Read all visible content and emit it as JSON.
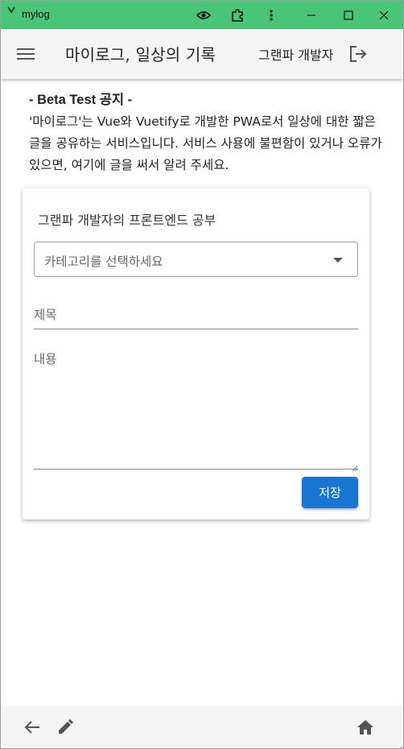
{
  "window": {
    "title": "mylog",
    "app_icon": "chevron-logo-icon",
    "buttons": [
      "eye-icon",
      "extension-icon",
      "more-vert-icon",
      "minimize-icon",
      "maximize-icon",
      "close-icon"
    ]
  },
  "appbar": {
    "title": "마이로그, 일상의 기록",
    "user_name": "그랜파 개발자",
    "menu_icon": "hamburger-menu-icon",
    "logout_icon": "logout-icon"
  },
  "notice": {
    "title": "- Beta Test 공지 -",
    "body": "'마이로그'는 Vue와 Vuetify로 개발한 PWA로서 일상에 대한 짧은 글을 공유하는 서비스입니다. 서비스 사용에 불편함이 있거나 오류가 있으면, 여기에 글을 써서 알려 주세요."
  },
  "card": {
    "title": "그랜파 개발자의 프론트엔드 공부",
    "category_placeholder": "카테고리를 선택하세요",
    "title_field_label": "제목",
    "content_field_label": "내용",
    "save_label": "저장"
  },
  "bottombar": {
    "icons": [
      "arrow-back-icon",
      "pencil-icon",
      "home-icon"
    ]
  },
  "colors": {
    "titlebar": "#4ac476",
    "primary": "#1976d2",
    "appbar": "#f5f5f5"
  }
}
